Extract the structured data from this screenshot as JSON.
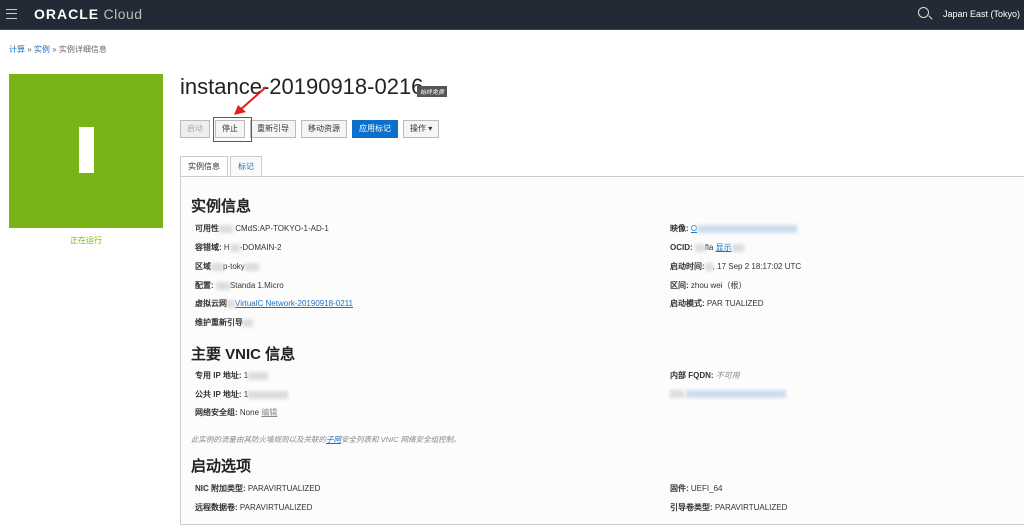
{
  "header": {
    "brand": "ORACLE",
    "brand_suffix": "Cloud",
    "region": "Japan East (Tokyo)"
  },
  "breadcrumb": {
    "items": [
      "计算",
      "实例",
      "实例详细信息"
    ],
    "sep": "»"
  },
  "instance": {
    "name": "instance-20190918-0216",
    "badge": "始终免费",
    "status": "正在运行",
    "status_color": "#7ab317"
  },
  "actions": [
    "启动",
    "停止",
    "重新引导",
    "移动资源",
    "应用标记",
    "操作"
  ],
  "tabs": [
    "实例信息",
    "标记"
  ],
  "instance_info": {
    "title": "实例信息",
    "left": [
      {
        "label": "可用性",
        "value": "CMdS:AP-TOKYO-1-AD-1"
      },
      {
        "label": "容错域:",
        "value": "-DOMAIN-2"
      },
      {
        "label": "区域",
        "value": "p-toky"
      },
      {
        "label": "配置:",
        "value": "Standa      1.Micro"
      },
      {
        "label": "虚拟云网",
        "value": "VirtualC      Network-20190918-0211"
      },
      {
        "label": "维护重新引导",
        "value": ""
      }
    ],
    "right": [
      {
        "label": "映像:",
        "value": "O"
      },
      {
        "label": "OCID:",
        "value": "fla",
        "extra": "显示"
      },
      {
        "label": "启动时间:",
        "value": ", 17 Sep 2      18:17:02 UTC"
      },
      {
        "label": "区间:",
        "value": "zhou      wei（根）"
      },
      {
        "label": "启动模式:",
        "value": "PAR      TUALIZED"
      }
    ]
  },
  "vnic": {
    "title": "主要 VNIC 信息",
    "left": [
      {
        "label": "专用 IP 地址:",
        "value": "1"
      },
      {
        "label": "公共 IP 地址:",
        "value": "1"
      },
      {
        "label": "网络安全组:",
        "value": "None",
        "extra": "编辑"
      }
    ],
    "right": [
      {
        "label": "内部 FQDN:",
        "value": "不可用"
      }
    ],
    "note_pre": "此实例的流量由其防火墙规则以及关联的",
    "note_link": "子网",
    "note_post": "安全列表和 VNIC 网络安全组控制。"
  },
  "launch": {
    "title": "启动选项",
    "left": [
      {
        "label": "NIC 附加类型:",
        "value": "PARAVIRTUALIZED"
      },
      {
        "label": "远程数据卷:",
        "value": "PARAVIRTUALIZED"
      }
    ],
    "right": [
      {
        "label": "固件:",
        "value": "UEFI_64"
      },
      {
        "label": "引导卷类型:",
        "value": "PARAVIRTUALIZED"
      }
    ]
  },
  "colors": {
    "header": "#222b35",
    "primary": "#0a70cc",
    "highlight": "#e02020"
  }
}
